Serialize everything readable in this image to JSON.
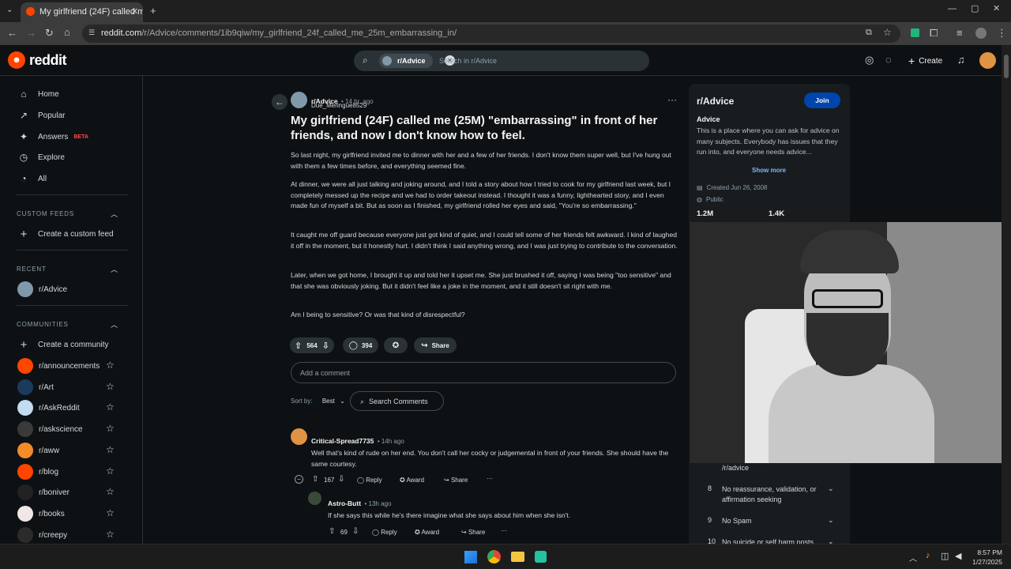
{
  "browser": {
    "tab_title": "My girlfriend (24F) called me (2",
    "url_host": "reddit.com",
    "url_path": "/r/Advice/comments/1ib9qiw/my_girlfriend_24f_called_me_25m_embarrassing_in/"
  },
  "header": {
    "logo_text": "reddit",
    "search_chip": "r/Advice",
    "search_placeholder": "Search in r/Advice",
    "create_label": "Create"
  },
  "sidebar": {
    "main": [
      {
        "label": "Home",
        "icon": "home-icon"
      },
      {
        "label": "Popular",
        "icon": "popular-icon"
      },
      {
        "label": "Answers",
        "icon": "answers-icon",
        "badge": "BETA"
      },
      {
        "label": "Explore",
        "icon": "explore-icon"
      },
      {
        "label": "All",
        "icon": "all-icon"
      }
    ],
    "custom_feeds_title": "CUSTOM FEEDS",
    "create_custom_feed": "Create a custom feed",
    "recent_title": "RECENT",
    "recent": [
      {
        "label": "r/Advice"
      }
    ],
    "communities_title": "COMMUNITIES",
    "create_community": "Create a community",
    "communities": [
      {
        "label": "r/announcements",
        "color": "#ff4500"
      },
      {
        "label": "r/Art",
        "color": "#1b3a5c"
      },
      {
        "label": "r/AskReddit",
        "color": "#c2dcf1"
      },
      {
        "label": "r/askscience",
        "color": "#3a3a3a"
      },
      {
        "label": "r/aww",
        "color": "#f28c28"
      },
      {
        "label": "r/blog",
        "color": "#ff4500"
      },
      {
        "label": "r/boniver",
        "color": "#222222"
      },
      {
        "label": "r/books",
        "color": "#f0e6e6"
      },
      {
        "label": "r/creepy",
        "color": "#2b2b2b"
      }
    ]
  },
  "post": {
    "subreddit": "r/Advice",
    "time": "14 hr. ago",
    "author": "Due_Meringue8529",
    "title": "My girlfriend (24F) called me (25M) \"embarrassing\" in front of her friends, and now I don't know how to feel.",
    "paragraphs": [
      "So last night, my girlfriend invited me to dinner with her and a few of her friends. I don't know them super well, but I've hung out with them a few times before, and everything seemed fine.",
      "At dinner, we were all just talking and joking around, and I told a story about how I tried to cook for my girlfriend last week, but I completely messed up the recipe and we had to order takeout instead. I thought it was a funny, lighthearted story, and I even made fun of myself a bit. But as soon as I finished, my girlfriend rolled her eyes and said, \"You're so embarrassing.\"",
      "It caught me off guard because everyone just got kind of quiet, and I could tell some of her friends felt awkward. I kind of laughed it off in the moment, but it honestly hurt. I didn't think I said anything wrong, and I was just trying to contribute to the conversation.",
      "Later, when we got home, I brought it up and told her it upset me. She just brushed it off, saying I was being \"too sensitive\" and that she was obviously joking. But it didn't feel like a joke in the moment, and it still doesn't sit right with me.",
      "Am I being to sensitive? Or was that kind of disrespectful?"
    ],
    "votes": "564",
    "comments_count": "394",
    "share_label": "Share",
    "add_comment_placeholder": "Add a comment",
    "sort_label": "Sort by:",
    "sort_value": "Best",
    "search_comments": "Search Comments"
  },
  "comments": [
    {
      "author": "Critical-Spread7735",
      "time": "14h ago",
      "text": "Well that's kind of rude on her end. You don't call her cocky or judgemental in front of your friends. She should have the same courtesy.",
      "votes": "167",
      "reply": "Reply",
      "award": "Award",
      "share": "Share"
    },
    {
      "author": "Astro-Butt",
      "time": "13h ago",
      "text": "If she says this while he's there imagine what she says about him when she isn't.",
      "votes": "69",
      "reply": "Reply",
      "award": "Award",
      "share": "Share"
    }
  ],
  "community": {
    "name": "r/Advice",
    "join_label": "Join",
    "title": "Advice",
    "description": "This is a place where you can ask for advice on many subjects. Everybody has issues that they run into, and everyone needs advice...",
    "show_more": "Show more",
    "created": "Created Jun 26, 2008",
    "visibility": "Public",
    "members": "1.2M",
    "online": "1.4K",
    "partial_rule": "/r/advice",
    "rules": [
      {
        "num": "8",
        "text": "No reassurance, validation, or affirmation seeking"
      },
      {
        "num": "9",
        "text": "No Spam"
      },
      {
        "num": "10",
        "text": "No suicide or self harm posts"
      }
    ]
  },
  "taskbar": {
    "time": "8:57 PM",
    "date": "1/27/2025"
  }
}
